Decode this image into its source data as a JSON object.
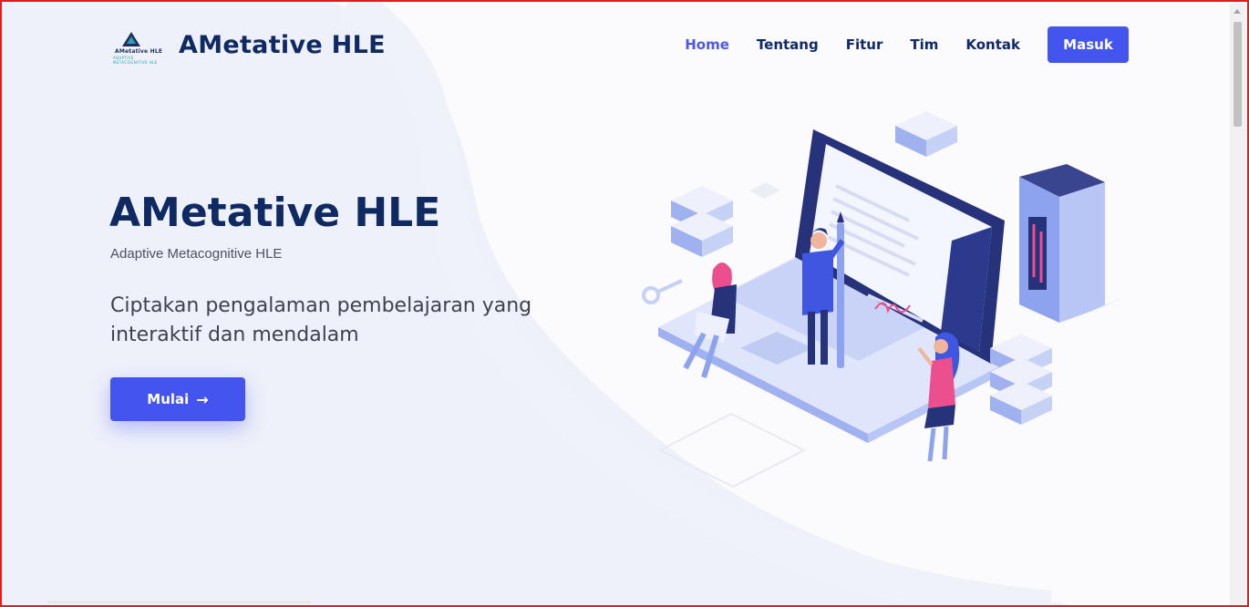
{
  "brand": {
    "name": "AMetative HLE",
    "logo_mark_text": "AMetative HLE",
    "logo_mark_subtext": "ADAPTIVE METACOGNITIVE HLE"
  },
  "nav": {
    "items": [
      {
        "label": "Home",
        "active": true
      },
      {
        "label": "Tentang",
        "active": false
      },
      {
        "label": "Fitur",
        "active": false
      },
      {
        "label": "Tim",
        "active": false
      },
      {
        "label": "Kontak",
        "active": false
      }
    ],
    "login_label": "Masuk"
  },
  "hero": {
    "title": "AMetative HLE",
    "subtitle": "Adaptive Metacognitive HLE",
    "description": "Ciptakan pengalaman pembelajaran yang interaktif dan mendalam",
    "cta_label": "Mulai",
    "cta_icon": "arrow-right-icon"
  },
  "colors": {
    "primary": "#4454ee",
    "heading": "#0f2a63",
    "nav_active": "#4e58e0",
    "background": "#f4f6fc",
    "frame_border": "#e31b1b"
  }
}
